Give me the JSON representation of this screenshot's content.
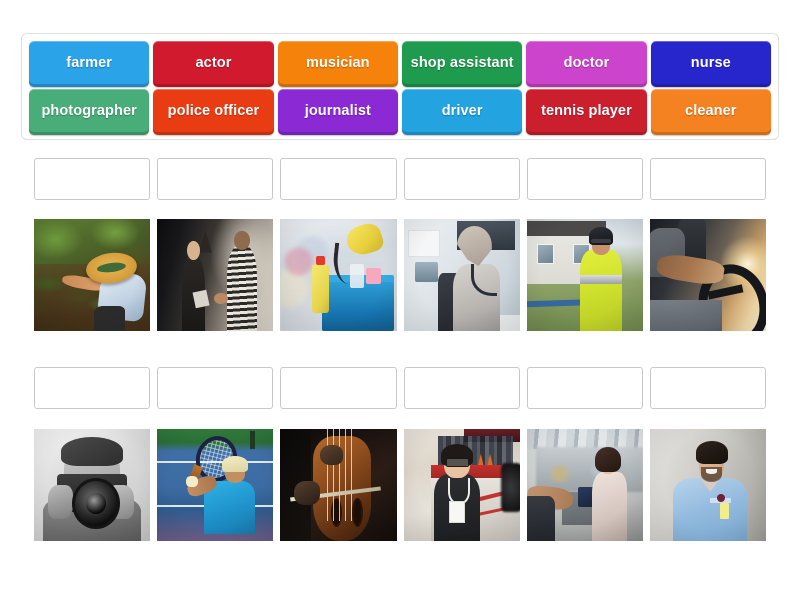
{
  "activity": {
    "type": "match-up-drag-and-drop",
    "title": "Jobs matching activity",
    "background_color": "#ffffff"
  },
  "word_bank": {
    "name": "draggable word tiles",
    "border_color": "#e0e0e0",
    "rows": [
      [
        {
          "label": "farmer",
          "color": "#2aa3e8"
        },
        {
          "label": "actor",
          "color": "#d11a2d"
        },
        {
          "label": "musician",
          "color": "#f5820b"
        },
        {
          "label": "shop assistant",
          "color": "#1e9b4e"
        },
        {
          "label": "doctor",
          "color": "#cc44cc"
        },
        {
          "label": "nurse",
          "color": "#2626cc"
        }
      ],
      [
        {
          "label": "photographer",
          "color": "#49ad79"
        },
        {
          "label": "police officer",
          "color": "#ea3c12"
        },
        {
          "label": "journalist",
          "color": "#8b2ad4"
        },
        {
          "label": "driver",
          "color": "#23a3e0"
        },
        {
          "label": "tennis player",
          "color": "#cc1f2e"
        },
        {
          "label": "cleaner",
          "color": "#f58220"
        }
      ]
    ]
  },
  "answer_rows": [
    {
      "name": "answer-row-1",
      "boxes": [
        {
          "value": "",
          "placeholder": ""
        },
        {
          "value": "",
          "placeholder": ""
        },
        {
          "value": "",
          "placeholder": ""
        },
        {
          "value": "",
          "placeholder": ""
        },
        {
          "value": "",
          "placeholder": ""
        },
        {
          "value": "",
          "placeholder": ""
        }
      ]
    },
    {
      "name": "answer-row-2",
      "boxes": [
        {
          "value": "",
          "placeholder": ""
        },
        {
          "value": "",
          "placeholder": ""
        },
        {
          "value": "",
          "placeholder": ""
        },
        {
          "value": "",
          "placeholder": ""
        },
        {
          "value": "",
          "placeholder": ""
        },
        {
          "value": "",
          "placeholder": ""
        }
      ]
    }
  ],
  "image_rows": [
    {
      "name": "image-row-1",
      "images": [
        {
          "alt": "farmer harvesting crops in a field wearing a straw hat",
          "key": "farmer"
        },
        {
          "alt": "two actors rehearsing a scene in a dark room",
          "key": "actor"
        },
        {
          "alt": "cleaning trolley with yellow glove and spray bottles",
          "key": "cleaner"
        },
        {
          "alt": "doctor with stethoscope sitting at a desk",
          "key": "doctor"
        },
        {
          "alt": "police officer in hi-vis jacket outside a house",
          "key": "police-officer"
        },
        {
          "alt": "driver's hands on a steering wheel in sunlight",
          "key": "driver"
        }
      ]
    },
    {
      "name": "image-row-2",
      "images": [
        {
          "alt": "black and white photo of a photographer with a camera",
          "key": "photographer"
        },
        {
          "alt": "tennis player hitting a ball on a blue court",
          "key": "tennis-player"
        },
        {
          "alt": "musician playing a cello with a bow",
          "key": "musician"
        },
        {
          "alt": "journalist holding a microphone reporting on location",
          "key": "journalist"
        },
        {
          "alt": "shop assistant serving a customer at a checkout",
          "key": "shop-assistant"
        },
        {
          "alt": "smiling nurse in blue scrubs with ID badge",
          "key": "nurse"
        }
      ]
    }
  ]
}
